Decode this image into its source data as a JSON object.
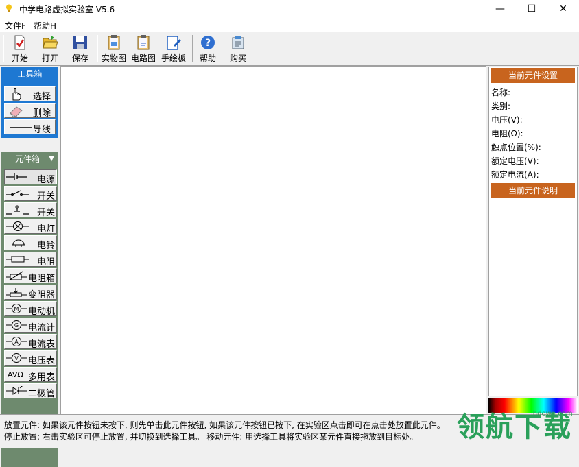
{
  "window": {
    "title": "中学电路虚拟实验室 V5.6",
    "controls": {
      "minimize": "—",
      "maximize": "☐",
      "close": "✕"
    }
  },
  "menu": {
    "items": [
      {
        "label": "文件F",
        "icon": "none"
      },
      {
        "label": "帮助H",
        "icon": "none"
      }
    ]
  },
  "toolbar": {
    "buttons": [
      {
        "label": "开始",
        "icon": "new-document-icon"
      },
      {
        "label": "打开",
        "icon": "open-folder-icon"
      },
      {
        "label": "保存",
        "icon": "save-disk-icon"
      },
      {
        "label": "实物图",
        "icon": "clipboard-icon"
      },
      {
        "label": "电路图",
        "icon": "clipboard-icon"
      },
      {
        "label": "手绘板",
        "icon": "pen-board-icon"
      },
      {
        "label": "帮助",
        "icon": "help-icon"
      },
      {
        "label": "购买",
        "icon": "cart-icon"
      }
    ]
  },
  "toolbox": {
    "title": "工具箱",
    "items": [
      {
        "label": "选择",
        "icon": "hand-pointer-icon"
      },
      {
        "label": "删除",
        "icon": "eraser-icon"
      },
      {
        "label": "导线",
        "icon": "wire-icon"
      }
    ]
  },
  "componentbox": {
    "title": "元件箱",
    "arrow": "▼",
    "items": [
      {
        "label": "电源",
        "icon": "battery-symbol-icon"
      },
      {
        "label": "开关",
        "icon": "switch-symbol-icon"
      },
      {
        "label": "开关",
        "icon": "push-switch-symbol-icon"
      },
      {
        "label": "电灯",
        "icon": "lamp-symbol-icon"
      },
      {
        "label": "电铃",
        "icon": "bell-symbol-icon"
      },
      {
        "label": "电阻",
        "icon": "resistor-symbol-icon"
      },
      {
        "label": "电阻箱",
        "icon": "resistor-box-symbol-icon"
      },
      {
        "label": "变阻器",
        "icon": "rheostat-symbol-icon"
      },
      {
        "label": "电动机",
        "icon": "motor-symbol-icon"
      },
      {
        "label": "电流计",
        "icon": "galvanometer-symbol-icon"
      },
      {
        "label": "电流表",
        "icon": "ammeter-symbol-icon"
      },
      {
        "label": "电压表",
        "icon": "voltmeter-symbol-icon"
      },
      {
        "label": "多用表",
        "icon": "multimeter-symbol-icon",
        "prefix": "AVΩ"
      },
      {
        "label": "二极管",
        "icon": "diode-symbol-icon"
      }
    ]
  },
  "settings": {
    "title": "当前元件设置",
    "props": [
      "名称:",
      "类别:",
      "电压(V):",
      "电阻(Ω):",
      "触点位置(%):",
      "额定电压(V):",
      "额定电流(A):"
    ],
    "desc_title": "当前元件说明"
  },
  "status": {
    "line1": "放置元件: 如果该元件按钮未按下, 则先单击此元件按钮, 如果该元件按钮已按下, 在实验区点击即可在点击处放置此元件。",
    "line2": "停止放置: 右击实验区可停止放置, 并切换到选择工具。 移动元件: 用选择工具将实验区某元件直接拖放到目标处。"
  },
  "watermark": {
    "text": "领航下载",
    "site": "lhdown.com"
  },
  "colors": {
    "toolbox_bg": "#1e78d2",
    "componentbox_bg": "#6e8a6e",
    "settings_header": "#c8641e"
  }
}
